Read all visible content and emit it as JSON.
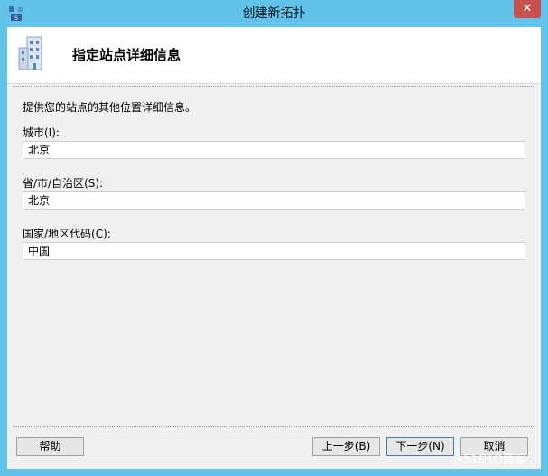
{
  "window": {
    "title": "创建新拓扑",
    "close_glyph": "✕"
  },
  "header": {
    "title": "指定站点详细信息",
    "icon": "building-icon"
  },
  "form": {
    "intro": "提供您的站点的其他位置详细信息。",
    "city_label": "城市(I):",
    "city_value": "北京",
    "state_label": "省/市/自治区(S):",
    "state_value": "北京",
    "country_label": "国家/地区代码(C):",
    "country_value": "中国"
  },
  "buttons": {
    "help": "帮助",
    "back": "上一步(B)",
    "next": "下一步(N)",
    "cancel": "取消"
  },
  "watermark": "@51CTO博客",
  "colors": {
    "frame": "#62c3ea",
    "close": "#c75050",
    "client": "#f0f0f0"
  }
}
